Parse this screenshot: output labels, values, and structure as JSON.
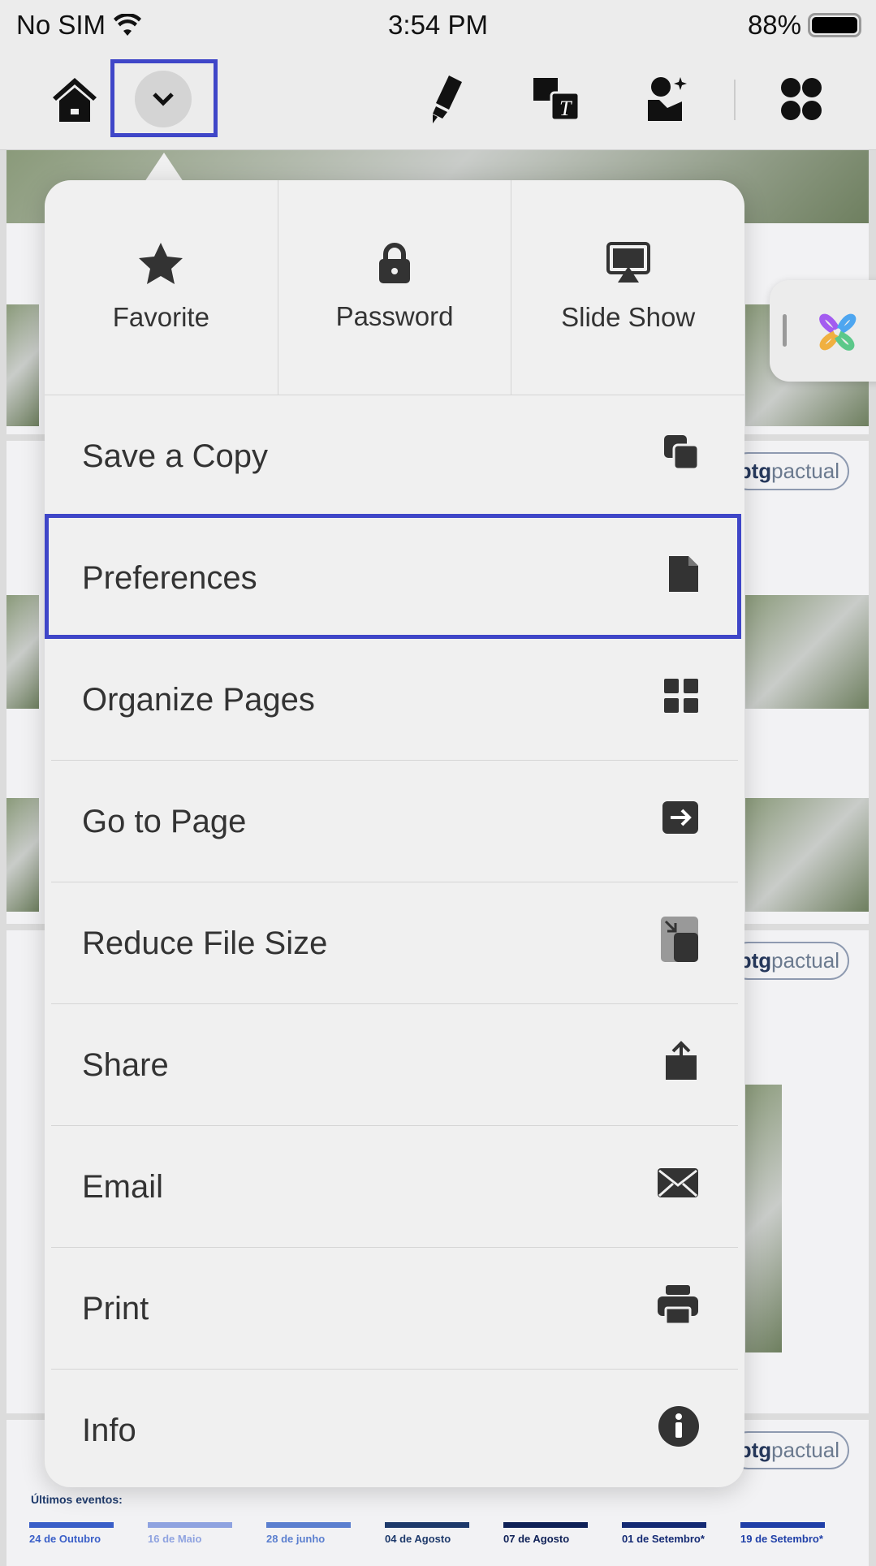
{
  "status": {
    "carrier": "No SIM",
    "time": "3:54 PM",
    "battery": "88%"
  },
  "toolbar": {
    "icons": [
      "home-icon",
      "chevron-down-icon",
      "highlighter-icon",
      "image-text-icon",
      "person-sparkle-icon",
      "clover-grid-icon"
    ]
  },
  "menu": {
    "top": [
      {
        "label": "Favorite",
        "icon": "star-icon"
      },
      {
        "label": "Password",
        "icon": "lock-icon"
      },
      {
        "label": "Slide Show",
        "icon": "slideshow-icon"
      }
    ],
    "items": [
      {
        "label": "Save a Copy",
        "icon": "copy-icon"
      },
      {
        "label": "Preferences",
        "icon": "document-icon"
      },
      {
        "label": "Organize Pages",
        "icon": "grid-icon"
      },
      {
        "label": "Go to Page",
        "icon": "arrow-right-box-icon"
      },
      {
        "label": "Reduce File Size",
        "icon": "reduce-file-icon"
      },
      {
        "label": "Share",
        "icon": "share-icon"
      },
      {
        "label": "Email",
        "icon": "envelope-icon"
      },
      {
        "label": "Print",
        "icon": "printer-icon"
      },
      {
        "label": "Info",
        "icon": "info-icon"
      }
    ]
  },
  "background": {
    "logo_bold": "btg",
    "logo_light": "pactual",
    "events_heading": "Últimos eventos:",
    "events": [
      "24 de Outubro",
      "16 de Maio",
      "28 de junho",
      "04 de Agosto",
      "07 de Agosto",
      "01 de Setembro*",
      "19 de Setembro*"
    ]
  },
  "colors": {
    "highlight": "#3f46c8",
    "event_colors": [
      "#3a5fc8",
      "#8fa3e0",
      "#5b7fcf",
      "#1e3a6b",
      "#0f2157",
      "#142a73",
      "#2040a8"
    ]
  }
}
